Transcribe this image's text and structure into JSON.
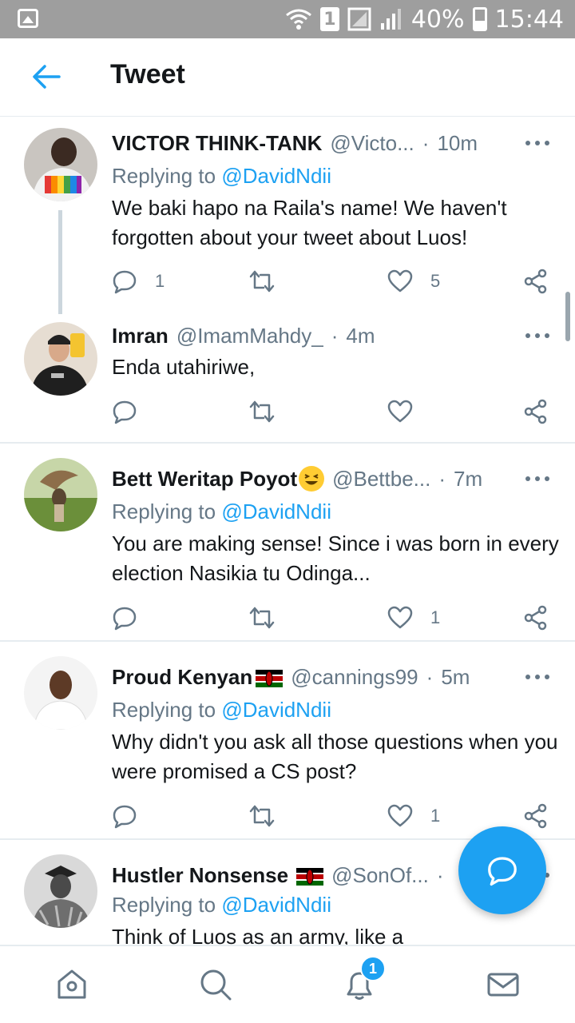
{
  "status_bar": {
    "battery": "40%",
    "time": "15:44",
    "sim": "1"
  },
  "header": {
    "title": "Tweet",
    "back_icon": "back-arrow-icon"
  },
  "tweets": [
    {
      "name": "VICTOR THINK-TANK",
      "handle": "@Victo...",
      "dot": "·",
      "time": "10m",
      "replying_prefix": "Replying to",
      "replying_to": "@DavidNdii",
      "text": "We baki hapo na Raila's name! We haven't forgotten about your tweet about Luos!",
      "reply_count": "1",
      "retweet_count": "",
      "like_count": "5"
    },
    {
      "name": "Imran",
      "handle": "@ImamMahdy_",
      "dot": "·",
      "time": "4m",
      "text": "Enda utahiriwe,",
      "reply_count": "",
      "retweet_count": "",
      "like_count": ""
    },
    {
      "name": "Bett Weritap Poyot",
      "handle": "@Bettbe...",
      "dot": "·",
      "time": "7m",
      "replying_prefix": "Replying to",
      "replying_to": "@DavidNdii",
      "text": "You are making sense! Since i was born in every election Nasikia tu Odinga...",
      "reply_count": "",
      "retweet_count": "",
      "like_count": "1"
    },
    {
      "name": "Proud Kenyan",
      "handle": "@cannings99",
      "dot": "·",
      "time": "5m",
      "replying_prefix": "Replying to",
      "replying_to": "@DavidNdii",
      "text": "Why didn't you ask all those questions when you were promised a CS post?",
      "reply_count": "",
      "retweet_count": "",
      "like_count": "1"
    },
    {
      "name": "Hustler Nonsense",
      "handle": "@SonOf...",
      "dot": "·",
      "time": "",
      "replying_prefix": "Replying to",
      "replying_to": "@DavidNdii",
      "text": "Think of Luos as an army, like a"
    }
  ],
  "bottom_nav": {
    "items": [
      "home-icon",
      "search-icon",
      "notifications-icon",
      "messages-icon"
    ],
    "notification_badge": "1"
  },
  "colors": {
    "accent": "#1da1f2",
    "text": "#14171a",
    "secondary": "#657786",
    "divider": "#e6ecf0",
    "status_bar": "#9e9e9e"
  }
}
